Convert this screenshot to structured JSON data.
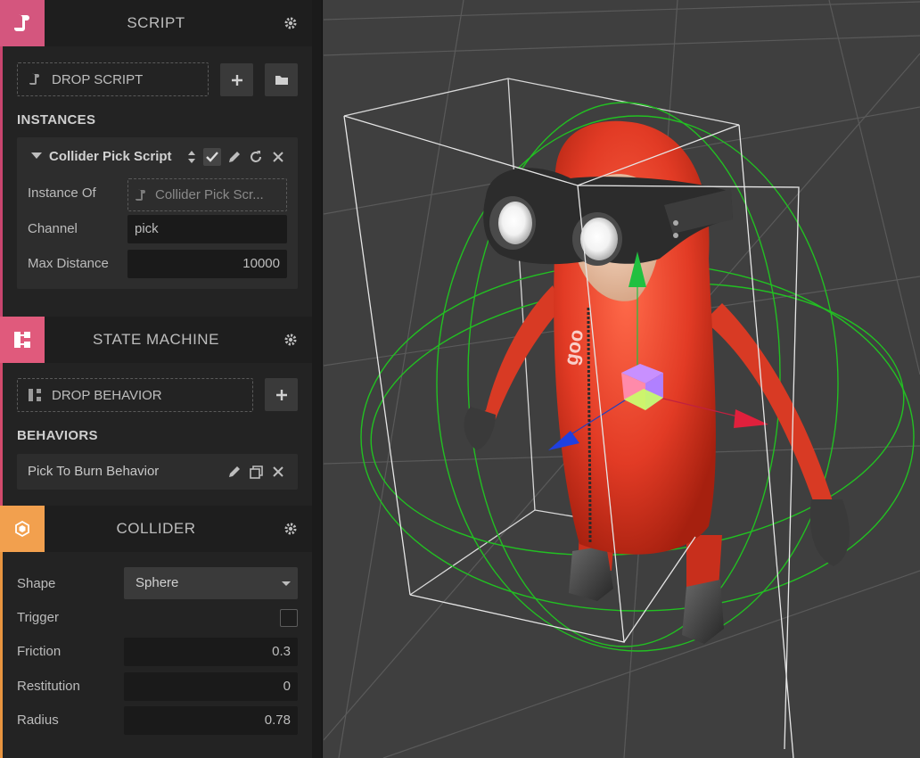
{
  "script_section": {
    "title": "SCRIPT",
    "accent_color": "#d9537a",
    "drop_label": "DROP SCRIPT",
    "instances_title": "INSTANCES",
    "instance": {
      "name": "Collider Pick Script",
      "instance_of_label": "Instance Of",
      "instance_of_value": "Collider Pick Scr...",
      "channel_label": "Channel",
      "channel_value": "pick",
      "max_distance_label": "Max Distance",
      "max_distance_value": "10000"
    }
  },
  "state_machine_section": {
    "title": "STATE MACHINE",
    "accent_color": "#e0577a",
    "drop_label": "DROP BEHAVIOR",
    "behaviors_title": "BEHAVIORS",
    "behavior_name": "Pick To Burn Behavior"
  },
  "collider_section": {
    "title": "COLLIDER",
    "accent_color": "#f0a050",
    "shape_label": "Shape",
    "shape_value": "Sphere",
    "trigger_label": "Trigger",
    "trigger_checked": false,
    "friction_label": "Friction",
    "friction_value": "0.3",
    "restitution_label": "Restitution",
    "restitution_value": "0",
    "radius_label": "Radius",
    "radius_value": "0.78"
  },
  "viewport": {
    "background": "#3f3f3f",
    "character_color": "#e8412b",
    "collider_color": "#22c022",
    "bounds_color": "#e6e6e6",
    "gizmo_colors": {
      "x": "#e0203c",
      "y": "#20c040",
      "z": "#2040e0"
    },
    "logo_text": "goo"
  }
}
